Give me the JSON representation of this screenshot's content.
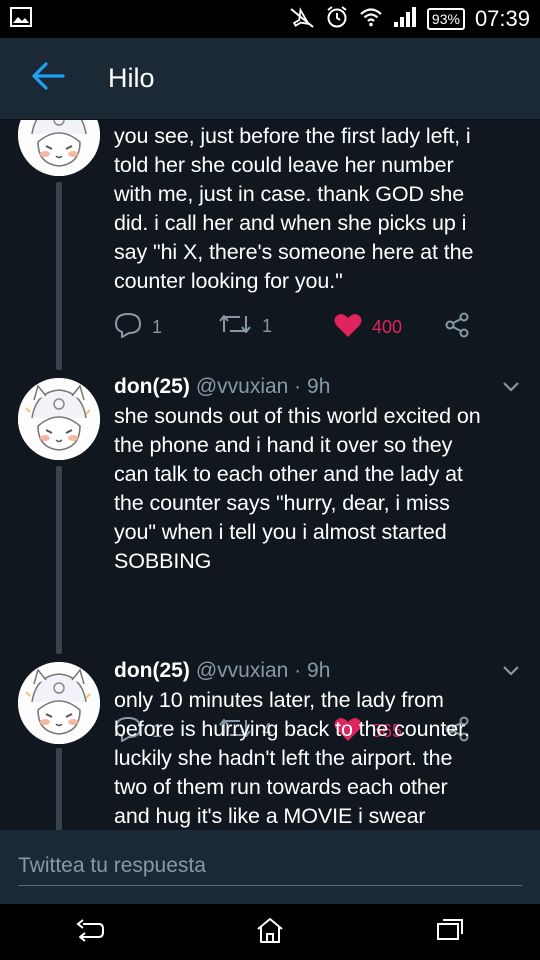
{
  "status_bar": {
    "battery": "93%",
    "time": "07:39"
  },
  "app_bar": {
    "title": "Hilo"
  },
  "tweets": [
    {
      "name": "",
      "handle": "",
      "text": "you see, just before the first lady left, i\ntold her she could leave her number\nwith me, just in case. thank GOD she\ndid. i call her and when she picks up i\nsay \"hi X, there's someone here at the\ncounter looking for you.\"",
      "replies": "1",
      "retweets": "1",
      "likes": "400"
    },
    {
      "name": "don(25)",
      "handle": "@vvuxian · 9h",
      "text": "she sounds out of this world excited on\nthe phone and i hand it over so they\ncan talk to each other and the lady at\nthe counter says \"hurry, dear, i miss\nyou\" when i tell you i almost started\nSOBBING",
      "replies": "1",
      "retweets": "4",
      "likes": "565"
    },
    {
      "name": "don(25)",
      "handle": "@vvuxian · 9h",
      "text": "only 10 minutes later, the lady from\nbefore is hurrying back to the counter.\nluckily she hadn't left the airport. the\ntwo of them run towards each other\nand hug     it's like a MOVIE i swear"
    }
  ],
  "reply_bar": {
    "placeholder": "Twittea tu respuesta"
  },
  "colors": {
    "background": "#10171e",
    "bar": "#1b2836",
    "accent": "#1da1f2",
    "like": "#e0245e",
    "muted": "#8899a6"
  },
  "icons": [
    "image-icon",
    "mute-icon",
    "alarm-icon",
    "wifi-icon",
    "signal-icon",
    "back-arrow-icon",
    "chevron-down-icon",
    "reply-icon",
    "retweet-icon",
    "heart-icon",
    "share-icon",
    "nav-back-icon",
    "nav-home-icon",
    "nav-recents-icon"
  ]
}
